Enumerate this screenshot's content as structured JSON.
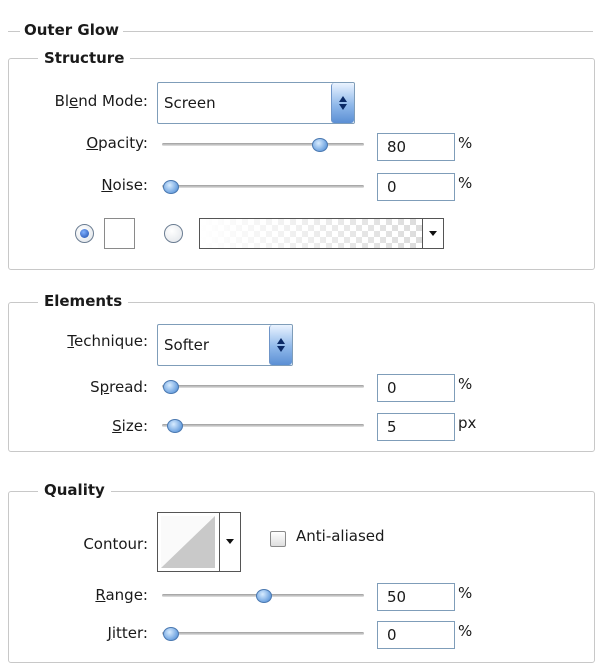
{
  "panel": {
    "title": "Outer Glow"
  },
  "structure": {
    "legend": "Structure",
    "blend_mode": {
      "label": "Blend Mode:",
      "value": "Screen"
    },
    "opacity": {
      "label": "Opacity:",
      "value": "80",
      "unit": "%",
      "level": 0.8
    },
    "noise": {
      "label": "Noise:",
      "value": "0",
      "unit": "%",
      "level": 0.0
    }
  },
  "elements": {
    "legend": "Elements",
    "technique": {
      "label": "Technique:",
      "value": "Softer"
    },
    "spread": {
      "label": "Spread:",
      "value": "0",
      "unit": "%",
      "level": 0.0
    },
    "size": {
      "label": "Size:",
      "value": "5",
      "unit": "px",
      "level": 0.02
    }
  },
  "quality": {
    "legend": "Quality",
    "contour": {
      "label": "Contour:"
    },
    "anti_aliased": {
      "label": "Anti-aliased",
      "checked": false
    },
    "range": {
      "label": "Range:",
      "value": "50",
      "unit": "%",
      "level": 0.5
    },
    "jitter": {
      "label": "Jitter:",
      "value": "0",
      "unit": "%",
      "level": 0.0
    }
  },
  "icons": {
    "spinner": "up-down-arrows-icon",
    "dropdown": "chevron-down-icon"
  },
  "colors": {
    "accent": "#5b8fd4",
    "glow_color": "#ffffff"
  }
}
